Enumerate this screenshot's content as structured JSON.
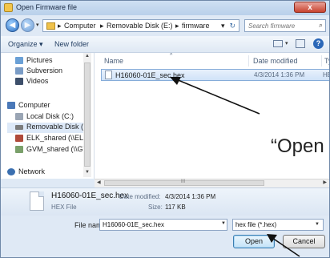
{
  "window": {
    "title": "Open Firmware file",
    "close_label": "x"
  },
  "address": {
    "crumbs": [
      "Computer",
      "Removable Disk (E:)",
      "firmware"
    ],
    "search_placeholder": "Search firmware"
  },
  "toolbar": {
    "organize_label": "Organize ▾",
    "new_folder_label": "New folder"
  },
  "nav": {
    "items": [
      {
        "label": "Pictures",
        "icon": "pictures-icon",
        "color": "#6aa0d6"
      },
      {
        "label": "Subversion",
        "icon": "subversion-icon",
        "color": "#7a9cc6"
      },
      {
        "label": "Videos",
        "icon": "videos-icon",
        "color": "#3d4f6a"
      },
      {
        "label": "Computer",
        "icon": "computer-icon",
        "color": "#4a78b8"
      },
      {
        "label": "Local Disk (C:)",
        "icon": "local-disk-icon",
        "color": "#9aa5b4"
      },
      {
        "label": "Removable Disk (",
        "icon": "removable-disk-icon",
        "color": "#7c7c7c",
        "selected": true
      },
      {
        "label": "ELK_shared (\\\\ELK",
        "icon": "network-drive-icon",
        "color": "#b04a3a"
      },
      {
        "label": "GVM_shared (\\\\GV",
        "icon": "network-drive-icon",
        "color": "#7aa06a"
      },
      {
        "label": "Network",
        "icon": "network-icon",
        "color": "#3a6fb0"
      }
    ]
  },
  "filelist": {
    "columns": {
      "name": "Name",
      "date": "Date modified",
      "type": "Type"
    },
    "rows": [
      {
        "name": "H16060-01E_sec.hex",
        "date": "4/3/2014 1:36 PM",
        "type": "HEX"
      }
    ]
  },
  "details": {
    "name": "H16060-01E_sec.hex",
    "type": "HEX File",
    "date_label": "Date modified:",
    "date_value": "4/3/2014 1:36 PM",
    "size_label": "Size:",
    "size_value": "117 KB"
  },
  "bottom": {
    "filename_label": "File name:",
    "filename_value": "H16060-01E_sec.hex",
    "filetype_value": "hex file (*.hex)",
    "open_label": "Open",
    "cancel_label": "Cancel"
  },
  "annotation": {
    "text": "“Open"
  },
  "colors": {
    "accent": "#3c7fb1",
    "selection": "#cfe2f8",
    "window_frame": "#6f88a8"
  }
}
